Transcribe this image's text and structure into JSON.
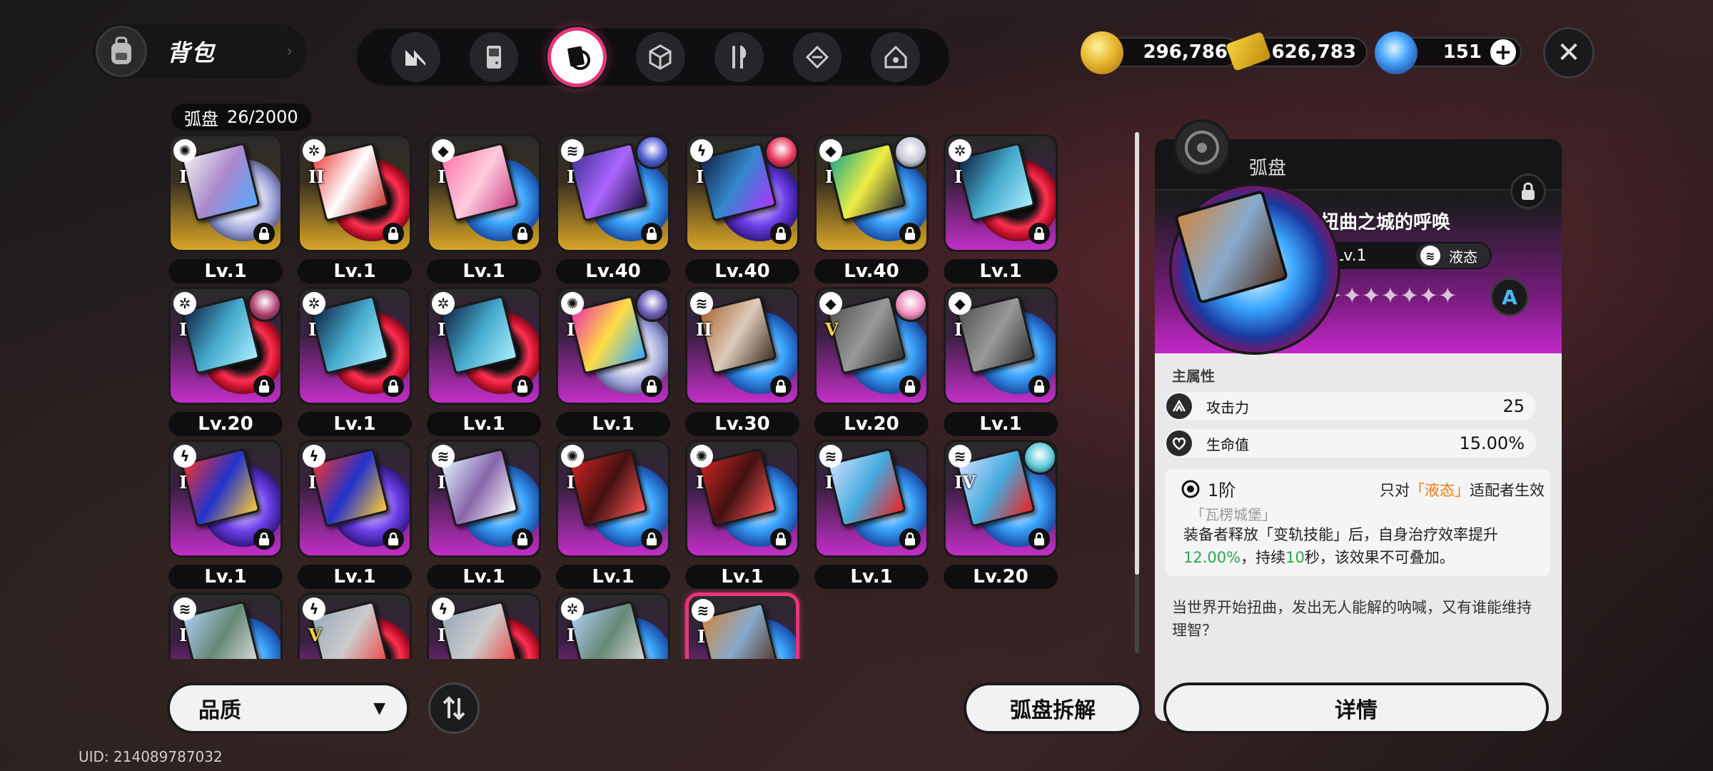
{
  "header": {
    "title": "背包",
    "tabs": [
      {
        "icon": "logo-icon"
      },
      {
        "icon": "gameboy-icon"
      },
      {
        "icon": "drive-disc-icon",
        "active": true
      },
      {
        "icon": "cube-icon"
      },
      {
        "icon": "utensils-icon"
      },
      {
        "icon": "box-icon"
      },
      {
        "icon": "home-icon"
      }
    ]
  },
  "currencies": {
    "coins": "296,786",
    "tickets": "626,783",
    "polychrome": "151"
  },
  "inventory": {
    "label": "弧盘",
    "count": "26/2000",
    "items": [
      {
        "level": "Lv.1",
        "rank": "I",
        "frame": "gold",
        "disc": "white",
        "cover": "c1",
        "type": "swirl"
      },
      {
        "level": "Lv.1",
        "rank": "II",
        "frame": "gold",
        "disc": "red",
        "cover": "c2",
        "type": "gear"
      },
      {
        "level": "Lv.1",
        "rank": "I",
        "frame": "gold",
        "disc": "blue",
        "cover": "c3",
        "type": "cube"
      },
      {
        "level": "Lv.40",
        "rank": "I",
        "frame": "gold",
        "disc": "blue",
        "cover": "c4",
        "type": "wave",
        "avatar": "#4a5ad0"
      },
      {
        "level": "Lv.40",
        "rank": "I",
        "frame": "gold",
        "disc": "violet",
        "cover": "c5",
        "type": "bolt",
        "avatar": "#e8305a"
      },
      {
        "level": "Lv.40",
        "rank": "I",
        "frame": "gold",
        "disc": "blue",
        "cover": "c6",
        "type": "cube",
        "avatar": "#c8c8d8"
      },
      {
        "level": "Lv.1",
        "rank": "I",
        "frame": "purple",
        "disc": "red",
        "cover": "c7",
        "type": "gear"
      },
      {
        "level": "Lv.20",
        "rank": "I",
        "frame": "purple",
        "disc": "red",
        "cover": "c7",
        "type": "gear",
        "avatar": "#b04070"
      },
      {
        "level": "Lv.1",
        "rank": "I",
        "frame": "purple",
        "disc": "red",
        "cover": "c7",
        "type": "gear"
      },
      {
        "level": "Lv.1",
        "rank": "I",
        "frame": "purple",
        "disc": "red",
        "cover": "c7",
        "type": "gear"
      },
      {
        "level": "Lv.1",
        "rank": "I",
        "frame": "purple",
        "disc": "white",
        "cover": "c8",
        "type": "swirl",
        "avatar": "#6a5ab8"
      },
      {
        "level": "Lv.30",
        "rank": "II",
        "frame": "purple",
        "disc": "blue",
        "cover": "c9",
        "type": "wave"
      },
      {
        "level": "Lv.20",
        "rank": "V",
        "rankGold": true,
        "frame": "purple",
        "disc": "blue",
        "cover": "c10",
        "type": "cube",
        "avatar": "#f090c0"
      },
      {
        "level": "Lv.1",
        "rank": "I",
        "frame": "purple",
        "disc": "blue",
        "cover": "c10",
        "type": "cube"
      },
      {
        "level": "Lv.1",
        "rank": "I",
        "frame": "purple",
        "disc": "violet",
        "cover": "c11",
        "type": "bolt"
      },
      {
        "level": "Lv.1",
        "rank": "I",
        "frame": "purple",
        "disc": "violet",
        "cover": "c11",
        "type": "bolt"
      },
      {
        "level": "Lv.1",
        "rank": "I",
        "frame": "purple",
        "disc": "blue",
        "cover": "c12",
        "type": "wave"
      },
      {
        "level": "Lv.1",
        "rank": "I",
        "frame": "purple",
        "disc": "blue",
        "cover": "c13",
        "type": "swirl"
      },
      {
        "level": "Lv.1",
        "rank": "I",
        "frame": "purple",
        "disc": "blue",
        "cover": "c13",
        "type": "swirl"
      },
      {
        "level": "Lv.1",
        "rank": "I",
        "frame": "purple",
        "disc": "blue",
        "cover": "c14",
        "type": "wave"
      },
      {
        "level": "Lv.20",
        "rank": "IV",
        "frame": "purple",
        "disc": "blue",
        "cover": "c14",
        "type": "wave",
        "avatar": "#5ac8d8"
      },
      {
        "level": "",
        "rank": "I",
        "frame": "purple",
        "disc": "blue",
        "cover": "c16",
        "type": "wave"
      },
      {
        "level": "",
        "rank": "V",
        "rankGold": true,
        "frame": "purple",
        "disc": "red",
        "cover": "c15",
        "type": "bolt"
      },
      {
        "level": "",
        "rank": "I",
        "frame": "purple",
        "disc": "red",
        "cover": "c15",
        "type": "bolt"
      },
      {
        "level": "",
        "rank": "I",
        "frame": "purple",
        "disc": "blue",
        "cover": "c16",
        "type": "gear"
      },
      {
        "level": "",
        "rank": "I",
        "frame": "purple",
        "disc": "blue",
        "cover": "c17",
        "type": "wave",
        "selected": true
      }
    ]
  },
  "controls": {
    "sort_label": "品质",
    "dismantle_label": "弧盘拆解",
    "uid": "UID: 214089787032"
  },
  "detail": {
    "category": "弧盘",
    "name": "扭曲之城的呼唤",
    "level": "Lv.1",
    "tag": "液态",
    "stars": "✦✦✦✦✦✦✦",
    "rank_badge": "A",
    "main_attr_title": "主属性",
    "stats": [
      {
        "name": "攻击力",
        "value": "25",
        "icon": "attack-icon"
      },
      {
        "name": "生命值",
        "value": "15.00%",
        "icon": "health-icon"
      }
    ],
    "effect": {
      "tier": "1阶",
      "target_pre": "只对",
      "target_tag": "「液态」",
      "target_post": "适配者生效",
      "subtitle": "「瓦楞城堡」",
      "body_pre": "装备者释放「变轨技能」后，自身治疗效率提升",
      "value1": "12.00%",
      "body_mid": "，持续",
      "value2": "10",
      "body_post": "秒，该效果不可叠加。"
    },
    "flavor": "当世界开始扭曲，发出无人能解的呐喊，又有谁能维持理智？",
    "details_button": "详情"
  },
  "colors": {
    "accent": "#e8357a",
    "gold_frame": "#d8a628",
    "purple_frame": "#c22ec8",
    "green": "#27a84a",
    "orange": "#f07a10"
  }
}
